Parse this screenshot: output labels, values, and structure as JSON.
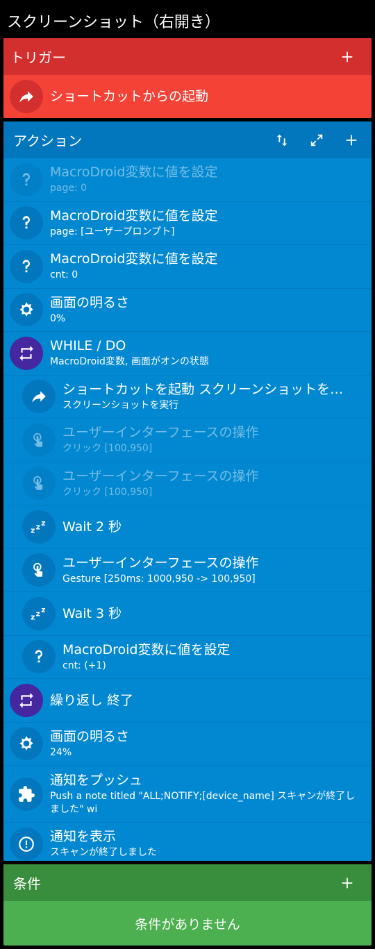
{
  "window_title": "スクリーンショット（右開き）",
  "trigger": {
    "header": "トリガー",
    "add_icon": "plus-icon",
    "item": {
      "icon": "shortcut-arrow-icon",
      "title": "ショートカットからの起動"
    }
  },
  "actions": {
    "header": "アクション",
    "header_icons": [
      "reorder-icon",
      "expand-icon",
      "plus-icon"
    ],
    "items": [
      {
        "icon": "question-icon",
        "title": "MacroDroid変数に値を設定",
        "sub": "page: 0",
        "nested": false,
        "disabled": true
      },
      {
        "icon": "question-icon",
        "title": "MacroDroid変数に値を設定",
        "sub": "page: [ユーザープロンプト]",
        "nested": false,
        "disabled": false
      },
      {
        "icon": "question-icon",
        "title": "MacroDroid変数に値を設定",
        "sub": "cnt: 0",
        "nested": false,
        "disabled": false
      },
      {
        "icon": "brightness-icon",
        "title": "画面の明るさ",
        "sub": "0%",
        "nested": false,
        "disabled": false
      },
      {
        "icon": "loop-icon",
        "title": "WHILE / DO",
        "sub": "MacroDroid変数, 画面がオンの状態",
        "nested": false,
        "disabled": false,
        "loop": true
      },
      {
        "icon": "shortcut-arrow-icon",
        "title": "ショートカットを起動 スクリーンショットを…",
        "sub": "スクリーンショットを実行",
        "nested": true,
        "disabled": false
      },
      {
        "icon": "touch-icon",
        "title": "ユーザーインターフェースの操作",
        "sub": "クリック [100,950]",
        "nested": true,
        "disabled": true
      },
      {
        "icon": "touch-icon",
        "title": "ユーザーインターフェースの操作",
        "sub": "クリック [100,950]",
        "nested": true,
        "disabled": true
      },
      {
        "icon": "sleep-icon",
        "title": "Wait 2 秒",
        "sub": "",
        "nested": true,
        "disabled": false
      },
      {
        "icon": "touch-icon",
        "title": "ユーザーインターフェースの操作",
        "sub": "Gesture [250ms: 1000,950 -> 100,950]",
        "nested": true,
        "disabled": false
      },
      {
        "icon": "sleep-icon",
        "title": "Wait 3 秒",
        "sub": "",
        "nested": true,
        "disabled": false
      },
      {
        "icon": "question-icon",
        "title": "MacroDroid変数に値を設定",
        "sub": "cnt: (+1)",
        "nested": true,
        "disabled": false
      },
      {
        "icon": "loop-icon",
        "title": "繰り返し 終了",
        "sub": "",
        "nested": false,
        "disabled": false,
        "loop": true
      },
      {
        "icon": "brightness-icon",
        "title": "画面の明るさ",
        "sub": "24%",
        "nested": false,
        "disabled": false
      },
      {
        "icon": "puzzle-icon",
        "title": "通知をプッシュ",
        "sub": "Push a note titled \"ALL;NOTIFY;[device_name] スキャンが終了しました\" wi",
        "nested": false,
        "disabled": false,
        "tall": true
      },
      {
        "icon": "alert-icon",
        "title": "通知を表示",
        "sub": "スキャンが終了しました",
        "nested": false,
        "disabled": false
      }
    ]
  },
  "conditions": {
    "header": "条件",
    "add_icon": "plus-icon",
    "empty_text": "条件がありません"
  },
  "colors": {
    "trigger": "#f44336",
    "trigger_header": "#d32f2f",
    "action": "#0288d1",
    "action_header": "#0277bd",
    "loop_icon_bg": "#4527a0",
    "condition": "#4caf50",
    "condition_header": "#388e3c"
  }
}
